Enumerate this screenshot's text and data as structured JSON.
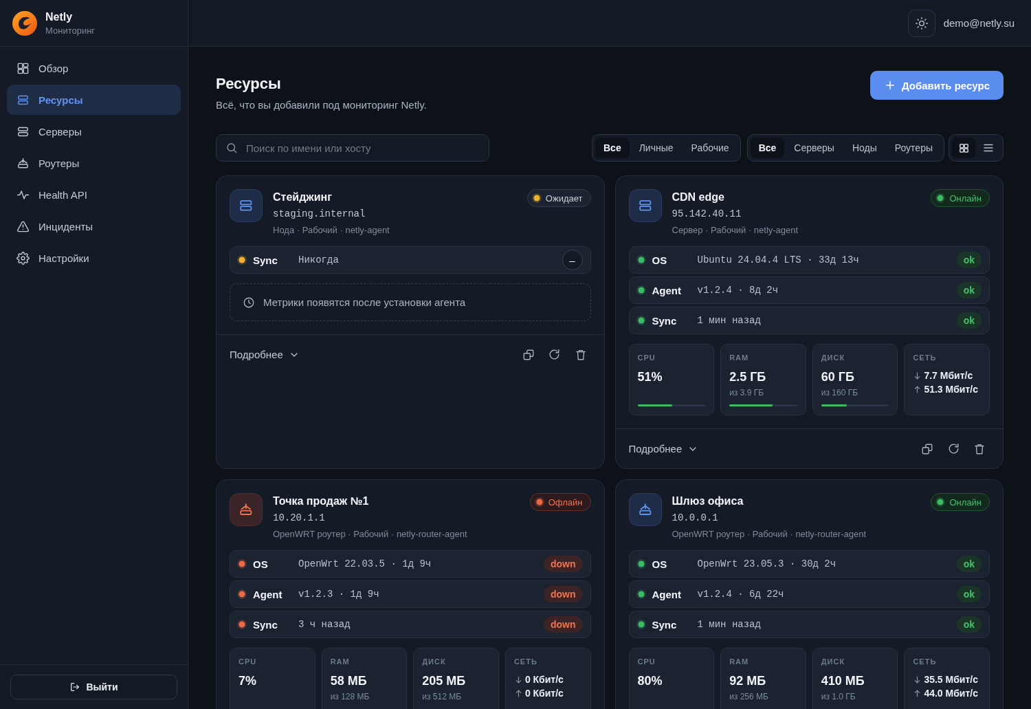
{
  "app": {
    "name": "Netly",
    "subtitle": "Мониторинг"
  },
  "sidebar": {
    "items": [
      {
        "kind": "overview",
        "label": "Обзор",
        "selected": false
      },
      {
        "kind": "resources",
        "label": "Ресурсы",
        "selected": true
      },
      {
        "kind": "servers",
        "label": "Серверы",
        "selected": false
      },
      {
        "kind": "routers",
        "label": "Роутеры",
        "selected": false
      },
      {
        "kind": "health",
        "label": "Health API",
        "selected": false
      },
      {
        "kind": "incidents",
        "label": "Инциденты",
        "selected": false
      },
      {
        "kind": "settings",
        "label": "Настройки",
        "selected": false
      }
    ],
    "logout": "Выйти"
  },
  "topbar": {
    "user": "demo@netly.su"
  },
  "page": {
    "title": "Ресурсы",
    "subtitle": "Всё, что вы добавили под мониторинг Netly.",
    "add_button": "Добавить ресурс"
  },
  "search": {
    "placeholder": "Поиск по имени или хосту"
  },
  "filter_groups": [
    {
      "options": [
        {
          "label": "Все",
          "selected": true
        },
        {
          "label": "Личные",
          "selected": false
        },
        {
          "label": "Рабочие",
          "selected": false
        }
      ]
    },
    {
      "options": [
        {
          "label": "Все",
          "selected": true
        },
        {
          "label": "Серверы",
          "selected": false
        },
        {
          "label": "Ноды",
          "selected": false
        },
        {
          "label": "Роутеры",
          "selected": false
        }
      ]
    }
  ],
  "view_toggle": [
    {
      "kind": "grid",
      "selected": true
    },
    {
      "kind": "list",
      "selected": false
    }
  ],
  "cards": [
    {
      "kind": "server",
      "name": "Стейджинг",
      "host": "staging.internal",
      "meta": "Нода · Рабочий · netly-agent",
      "status": {
        "kind": "pending",
        "label": "Ожидает"
      },
      "checks": [
        {
          "kind": "pending",
          "label": "Sync",
          "value": "Никогда",
          "badge": "–"
        }
      ],
      "notice": "Метрики появятся после установки агента",
      "details": "Подробнее"
    },
    {
      "kind": "server",
      "name": "CDN edge",
      "host": "95.142.40.11",
      "meta": "Сервер · Рабочий · netly-agent",
      "status": {
        "kind": "online",
        "label": "Онлайн"
      },
      "checks": [
        {
          "kind": "ok",
          "label": "OS",
          "value": "Ubuntu 24.04.4 LTS · 33д 13ч",
          "badge": "ok"
        },
        {
          "kind": "ok",
          "label": "Agent",
          "value": "v1.2.4 · 8д 2ч",
          "badge": "ok"
        },
        {
          "kind": "ok",
          "label": "Sync",
          "value": "1 мин назад",
          "badge": "ok"
        }
      ],
      "metrics": [
        {
          "kind": "gauge",
          "label": "CPU",
          "value": "51%",
          "level": 0.51
        },
        {
          "kind": "gauge",
          "label": "RAM",
          "value": "2.5 ГБ",
          "sub": "из 3.9 ГБ",
          "level": 0.64
        },
        {
          "kind": "gauge",
          "label": "ДИСК",
          "value": "60 ГБ",
          "sub": "из 160 ГБ",
          "level": 0.38
        },
        {
          "kind": "net",
          "label": "СЕТЬ",
          "down": "7.7 Мбит/с",
          "up": "51.3 Мбит/с"
        }
      ],
      "details": "Подробнее"
    },
    {
      "kind": "router",
      "name": "Точка продаж №1",
      "host": "10.20.1.1",
      "meta": "OpenWRT роутер · Рабочий · netly-router-agent",
      "status": {
        "kind": "offline",
        "label": "Офлайн"
      },
      "checks": [
        {
          "kind": "down",
          "label": "OS",
          "value": "OpenWrt 22.03.5 · 1д 9ч",
          "badge": "down"
        },
        {
          "kind": "down",
          "label": "Agent",
          "value": "v1.2.3 · 1д 9ч",
          "badge": "down"
        },
        {
          "kind": "down",
          "label": "Sync",
          "value": "3 ч назад",
          "badge": "down"
        }
      ],
      "metrics": [
        {
          "kind": "gauge",
          "label": "CPU",
          "value": "7%"
        },
        {
          "kind": "gauge",
          "label": "RAM",
          "value": "58 МБ",
          "sub": "из 128 МБ"
        },
        {
          "kind": "gauge",
          "label": "ДИСК",
          "value": "205 МБ",
          "sub": "из 512 МБ"
        },
        {
          "kind": "net",
          "label": "СЕТЬ",
          "down": "0 Кбит/с",
          "up": "0 Кбит/с"
        }
      ]
    },
    {
      "kind": "router",
      "name": "Шлюз офиса",
      "host": "10.0.0.1",
      "meta": "OpenWRT роутер · Рабочий · netly-router-agent",
      "status": {
        "kind": "online",
        "label": "Онлайн"
      },
      "checks": [
        {
          "kind": "ok",
          "label": "OS",
          "value": "OpenWrt 23.05.3 · 30д 2ч",
          "badge": "ok"
        },
        {
          "kind": "ok",
          "label": "Agent",
          "value": "v1.2.4 · 6д 22ч",
          "badge": "ok"
        },
        {
          "kind": "ok",
          "label": "Sync",
          "value": "1 мин назад",
          "badge": "ok"
        }
      ],
      "metrics": [
        {
          "kind": "gauge",
          "label": "CPU",
          "value": "80%"
        },
        {
          "kind": "gauge",
          "label": "RAM",
          "value": "92 МБ",
          "sub": "из 256 МБ"
        },
        {
          "kind": "gauge",
          "label": "ДИСК",
          "value": "410 МБ",
          "sub": "из 1.0 ГБ"
        },
        {
          "kind": "net",
          "label": "СЕТЬ",
          "down": "35.5 Мбит/с",
          "up": "44.0 Мбит/с"
        }
      ]
    }
  ]
}
